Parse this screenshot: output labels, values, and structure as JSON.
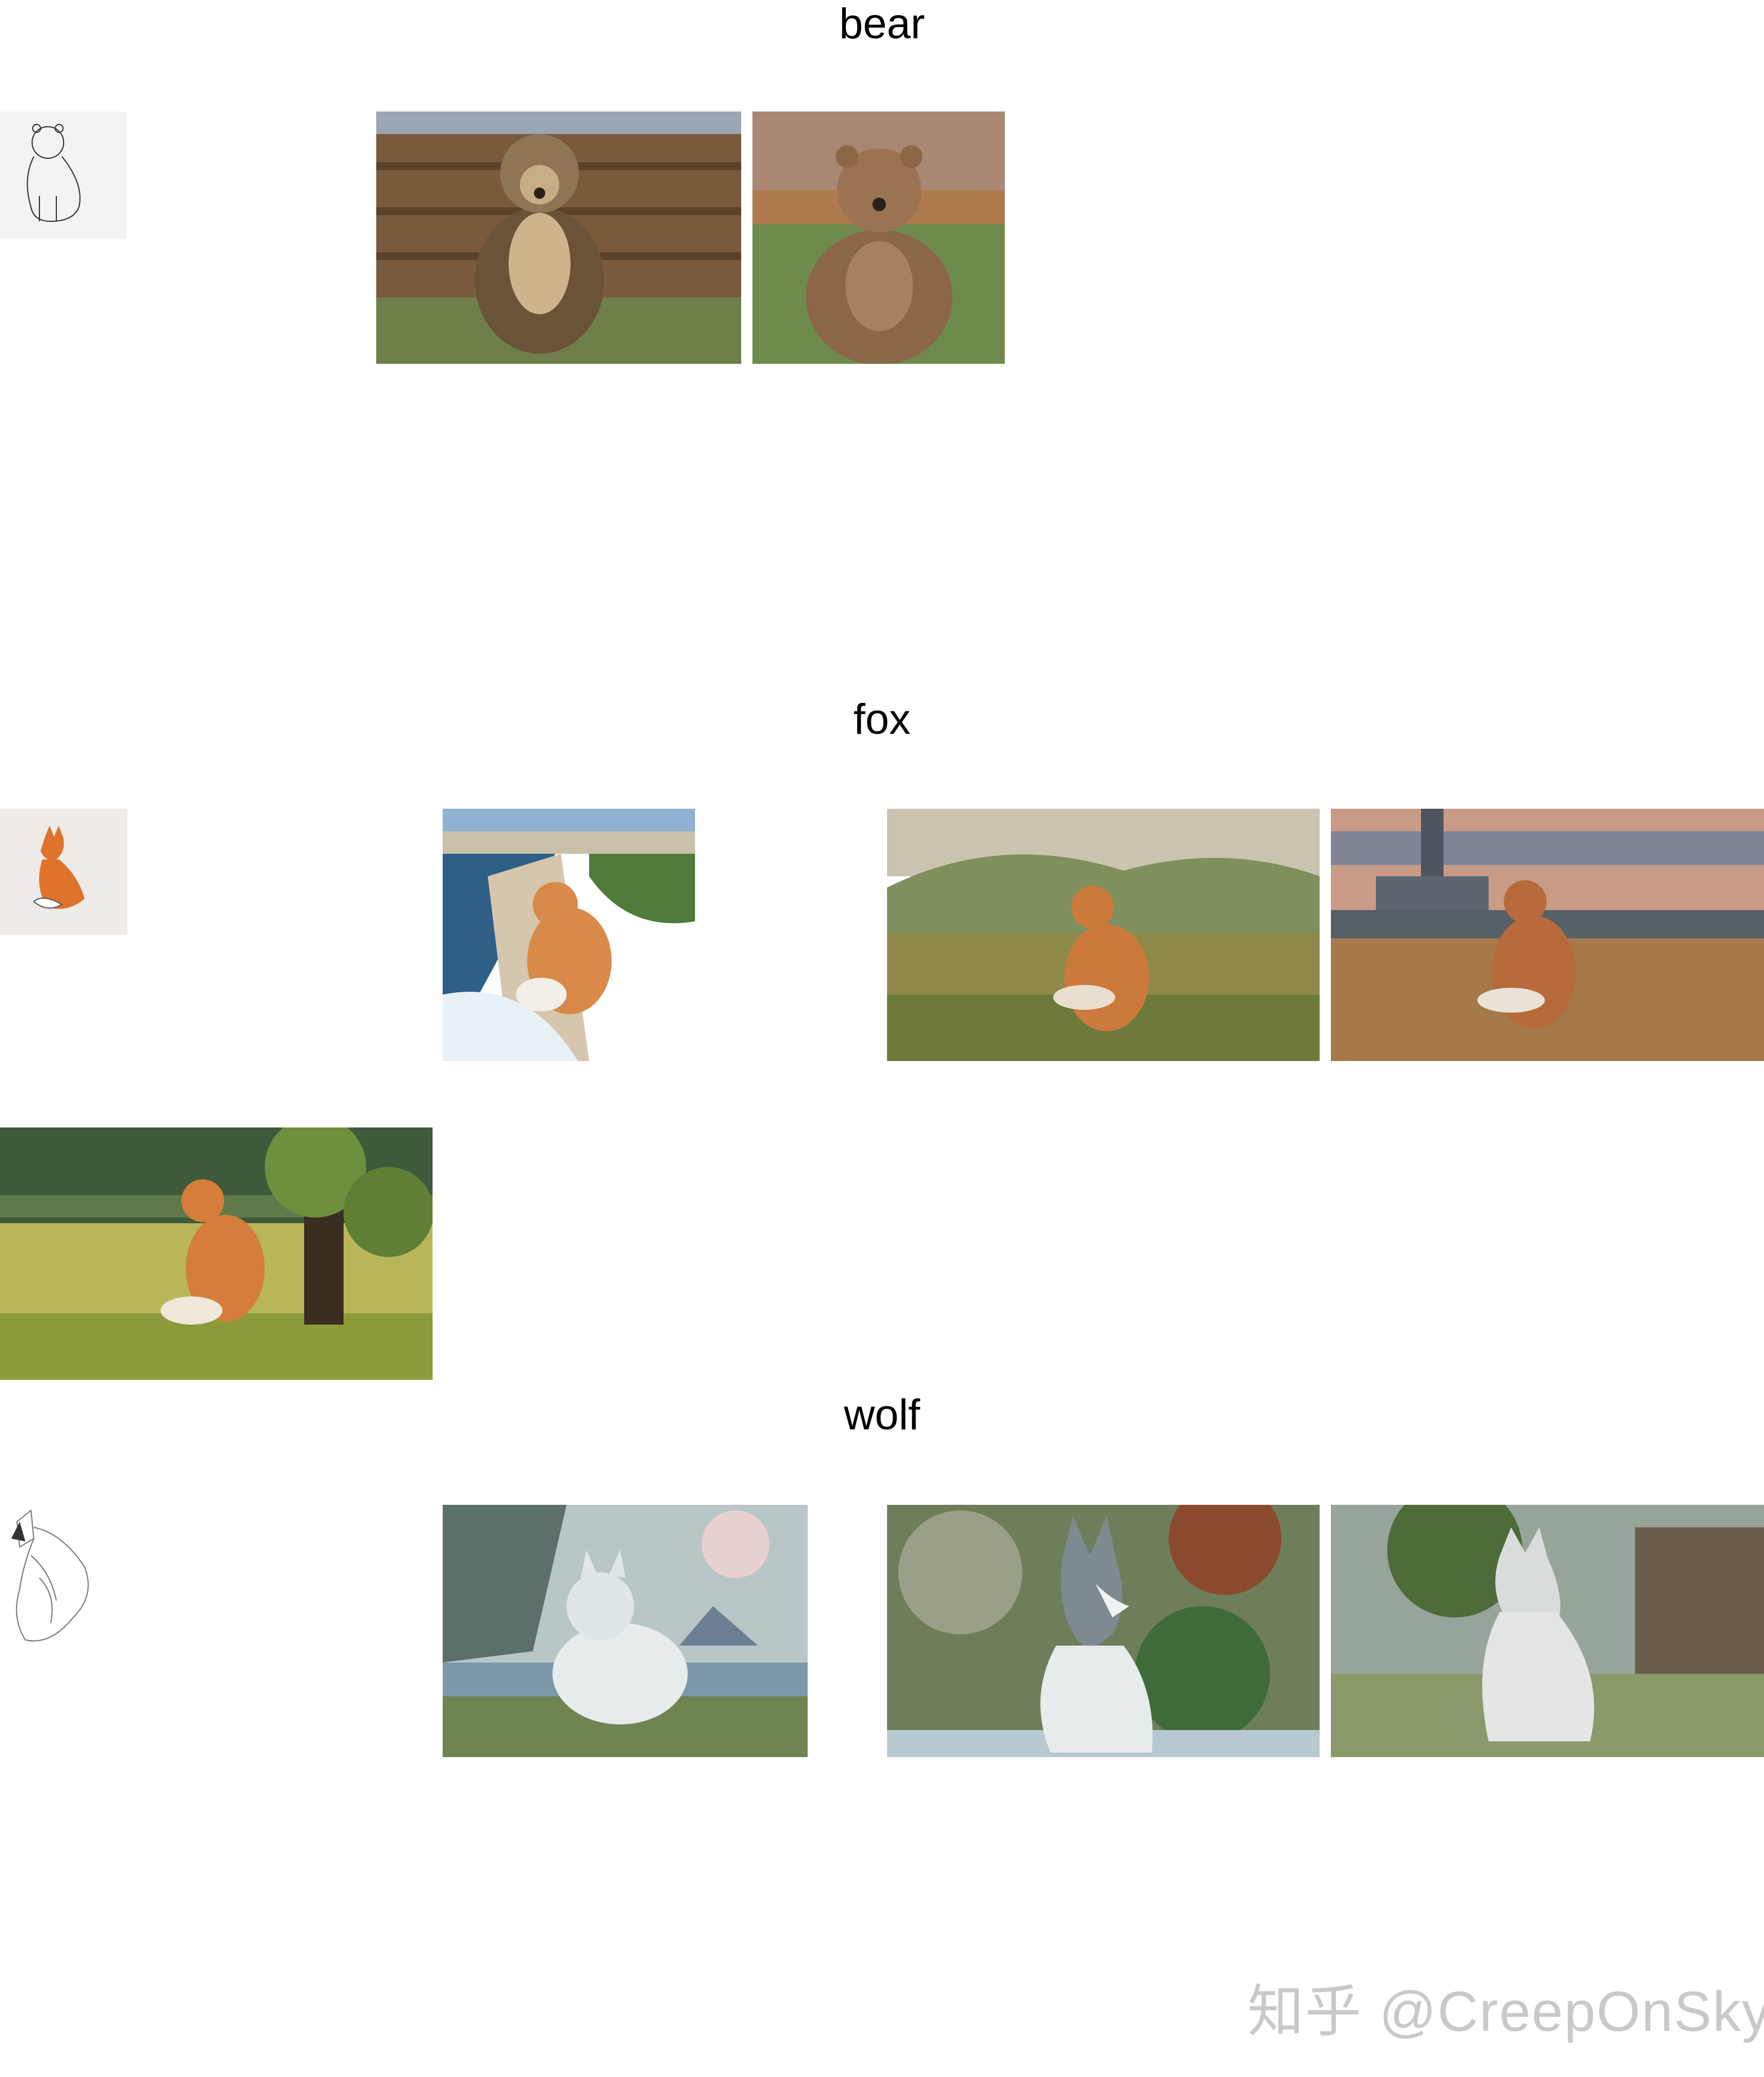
{
  "sections": [
    {
      "title": "bear"
    },
    {
      "title": "fox"
    },
    {
      "title": "wolf"
    }
  ],
  "watermark": "知乎 @CreepOnSky",
  "tiles": {
    "bear_sketch": {
      "subject": "bear line sketch"
    },
    "bear_1": {
      "subject": "bear sitting by wooden fence"
    },
    "bear_2": {
      "subject": "bear sitting in meadow"
    },
    "fox_sketch": {
      "subject": "fox sketch"
    },
    "fox_1": {
      "subject": "fox on coastal path"
    },
    "fox_2": {
      "subject": "fox in green valley"
    },
    "fox_3": {
      "subject": "fox in field with castle"
    },
    "fox_4": {
      "subject": "fox under tree in sunlit meadow"
    },
    "wolf_sketch": {
      "subject": "howling wolf sketch"
    },
    "wolf_1": {
      "subject": "white wolf in water"
    },
    "wolf_2": {
      "subject": "wolf lying under red leaves"
    },
    "wolf_3": {
      "subject": "white wolf walking in grass"
    }
  }
}
